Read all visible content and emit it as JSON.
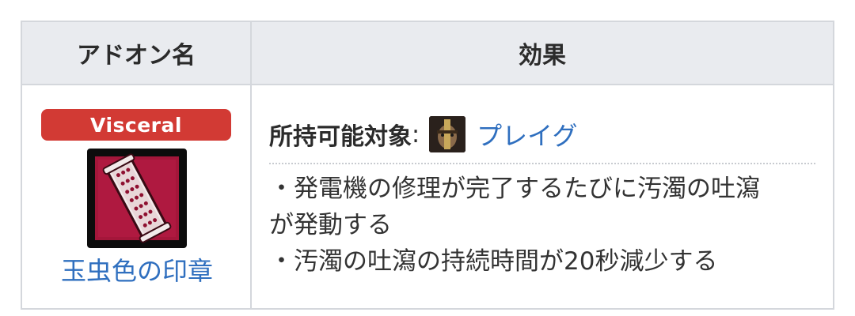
{
  "table": {
    "headers": {
      "addon_name": "アドオン名",
      "effect": "効果"
    },
    "addon": {
      "rarity": "Visceral",
      "rarity_color": "#d23a34",
      "icon": "iridescent-seal-addon-icon",
      "name": "玉虫色の印章",
      "owner_label": "所持可能対象",
      "owner_colon": ":",
      "owner_icon": "plague-portrait-icon",
      "owner_name": "プレイグ",
      "effects": [
        "・発電機の修理が完了するたびに汚濁の吐瀉",
        "が発動する",
        "・汚濁の吐瀉の持続時間が20秒減少する"
      ]
    }
  },
  "colors": {
    "link": "#2f6fbf",
    "header_bg": "#e9ebef",
    "border": "#d4d7dc"
  }
}
